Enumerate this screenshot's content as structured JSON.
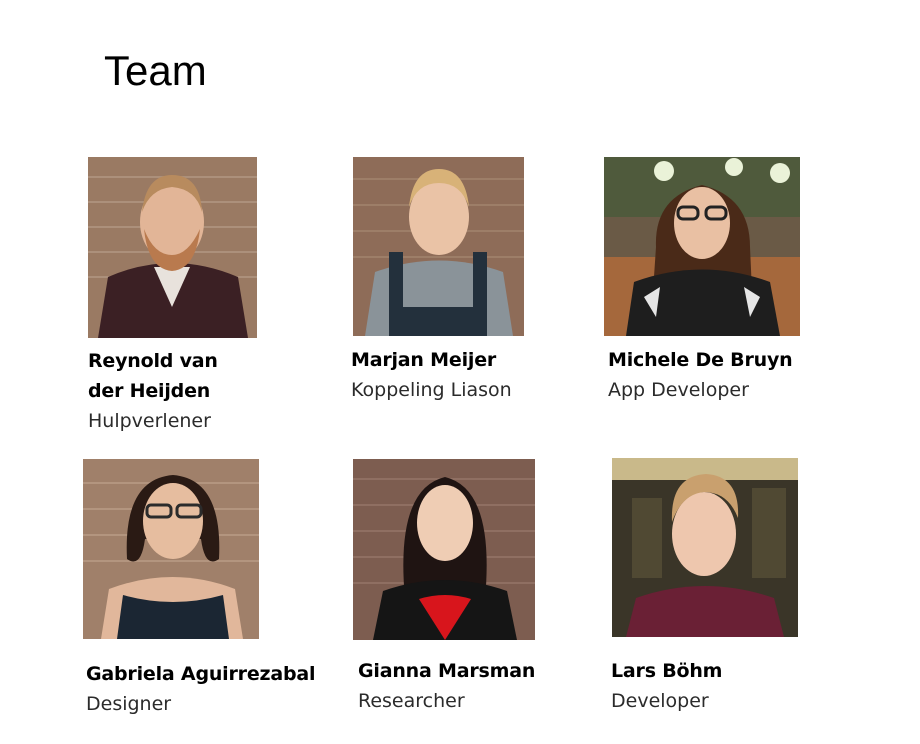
{
  "slide": {
    "title": "Team"
  },
  "members": [
    {
      "name_line1": "Reynold van",
      "name_line2": "der Heijden",
      "role": "Hulpverlener"
    },
    {
      "name": "Marjan Meijer",
      "role": "Koppeling Liason"
    },
    {
      "name": "Michele De Bruyn",
      "role": "App Developer"
    },
    {
      "name": "Gabriela Aguirrezabal",
      "role": "Designer"
    },
    {
      "name": "Gianna Marsman",
      "role": "Researcher"
    },
    {
      "name": "Lars Böhm",
      "role": "Developer"
    }
  ]
}
